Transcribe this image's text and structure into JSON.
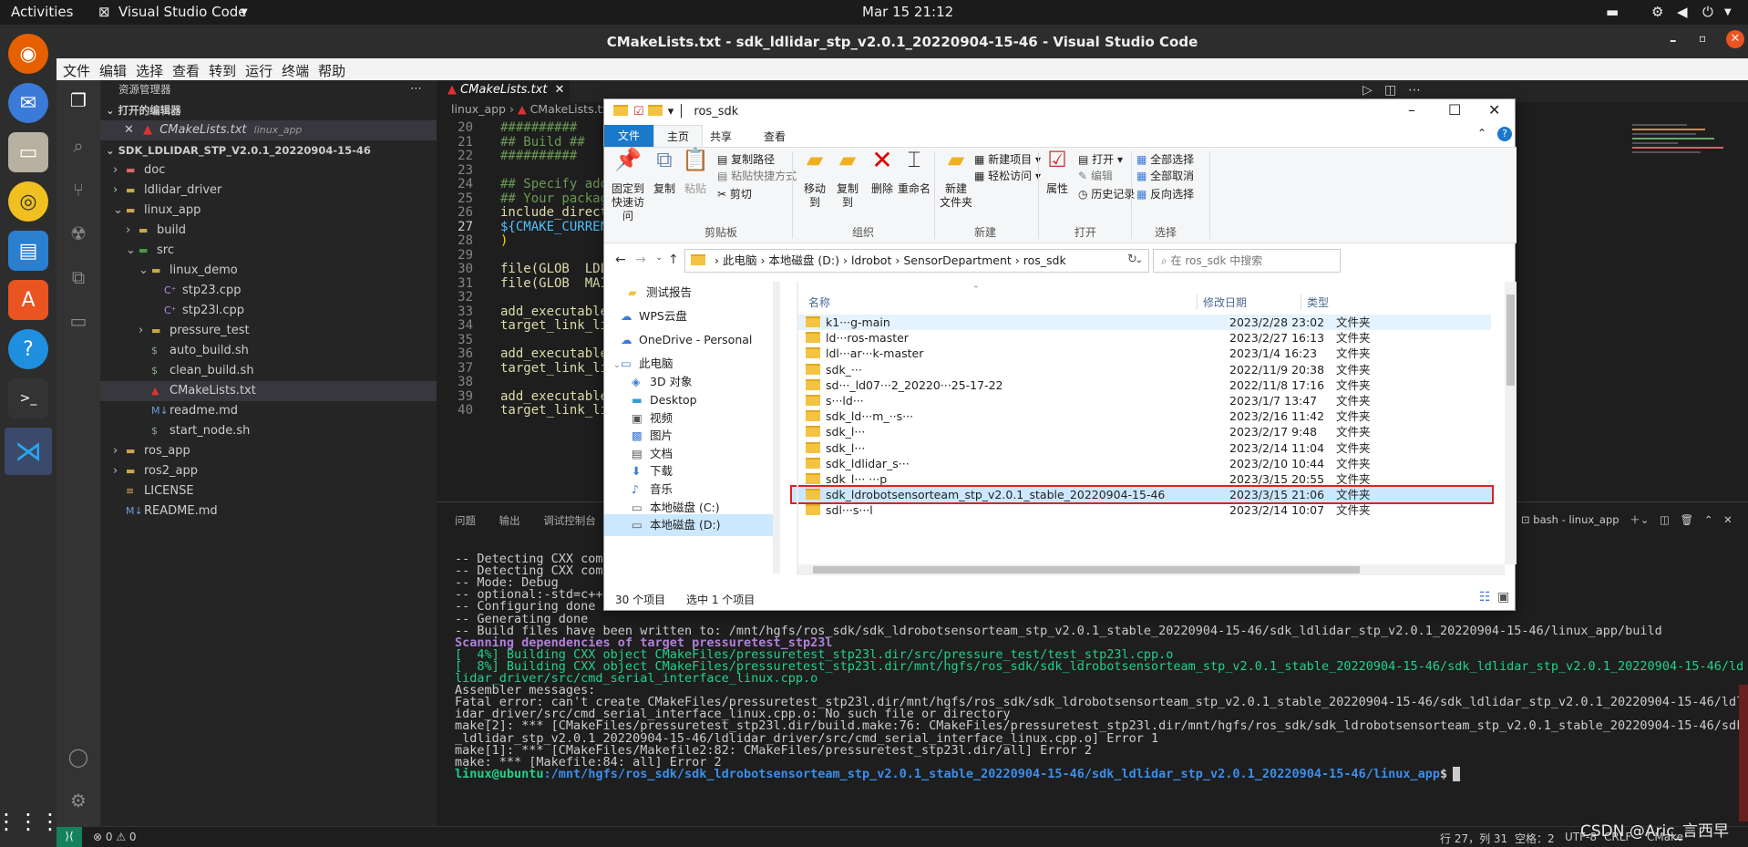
{
  "topbar": {
    "activities": "Activities",
    "app": "Visual Studio Code",
    "clock": "Mar 15  21:12"
  },
  "window_title": "CMakeLists.txt - sdk_ldlidar_stp_v2.0.1_20220904-15-46 - Visual Studio Code",
  "menu": [
    "文件",
    "编辑",
    "选择",
    "查看",
    "转到",
    "运行",
    "终端",
    "帮助"
  ],
  "sidebar": {
    "header": "资源管理器",
    "open_editors": "打开的编辑器",
    "open_file": "CMakeLists.txt",
    "open_file_path": "linux_app",
    "project": "SDK_LDLIDAR_STP_V2.0.1_20220904-15-46",
    "tree": [
      "doc",
      "ldlidar_driver",
      "linux_app",
      "build",
      "src",
      "linux_demo",
      "stp23.cpp",
      "stp23l.cpp",
      "pressure_test",
      "auto_build.sh",
      "clean_build.sh",
      "CMakeLists.txt",
      "readme.md",
      "start_node.sh",
      "ros_app",
      "ros2_app",
      "LICENSE",
      "README.md"
    ]
  },
  "editor": {
    "tab": "CMakeLists.txt",
    "breadcrumb": [
      "linux_app",
      "CMakeLists.txt"
    ],
    "line_numbers": [
      "20",
      "21",
      "22",
      "23",
      "24",
      "25",
      "26",
      "27",
      "28",
      "29",
      "30",
      "31",
      "32",
      "33",
      "34",
      "35",
      "36",
      "37",
      "38",
      "39",
      "40"
    ],
    "lines": [
      "##########",
      "## Build ##",
      "##########",
      "",
      "## Specify add",
      "## Your packag",
      "include_direct",
      "${CMAKE_CURREN",
      ")",
      "",
      "file(GLOB  LDL",
      "file(GLOB  MAI",
      "",
      "add_executable",
      "target_link_li",
      "",
      "add_executable",
      "target_link_li",
      "",
      "add_executable",
      "target_link_li"
    ]
  },
  "panel": {
    "tabs": [
      "问题",
      "输出",
      "调试控制台"
    ],
    "terminal_name": "bash - linux_app",
    "terminal": [
      "-- Detecting CXX comp",
      "-- Detecting CXX comp",
      "-- Mode: Debug",
      "-- optional:-std=c++1",
      "-- Configuring done",
      "-- Generating done",
      "-- Build files have been written to: /mnt/hgfs/ros_sdk/sdk_ldrobotsensorteam_stp_v2.0.1_stable_20220904-15-46/sdk_ldlidar_stp_v2.0.1_20220904-15-46/linux_app/build",
      "Scanning dependencies of target pressuretest_stp23l",
      "[  4%] Building CXX object CMakeFiles/pressuretest_stp23l.dir/src/pressure_test/test_stp23l.cpp.o",
      "[  8%] Building CXX object CMakeFiles/pressuretest_stp23l.dir/mnt/hgfs/ros_sdk/sdk_ldrobotsensorteam_stp_v2.0.1_stable_20220904-15-46/sdk_ldlidar_stp_v2.0.1_20220904-15-46/ld",
      "lidar_driver/src/cmd_serial_interface_linux.cpp.o",
      "Assembler messages:",
      "Fatal error: can't create CMakeFiles/pressuretest_stp23l.dir/mnt/hgfs/ros_sdk/sdk_ldrobotsensorteam_stp_v2.0.1_stable_20220904-15-46/sdk_ldlidar_stp_v2.0.1_20220904-15-46/ldl",
      "idar_driver/src/cmd_serial_interface_linux.cpp.o: No such file or directory",
      "make[2]: *** [CMakeFiles/pressuretest_stp23l.dir/build.make:76: CMakeFiles/pressuretest_stp23l.dir/mnt/hgfs/ros_sdk/sdk_ldrobotsensorteam_stp_v2.0.1_stable_20220904-15-46/sdk",
      "_ldlidar_stp_v2.0.1_20220904-15-46/ldlidar_driver/src/cmd_serial_interface_linux.cpp.o] Error 1",
      "make[1]: *** [CMakeFiles/Makefile2:82: CMakeFiles/pressuretest_stp23l.dir/all] Error 2",
      "make: *** [Makefile:84: all] Error 2"
    ],
    "prompt_user": "linux@ubuntu",
    "prompt_path": ":/mnt/hgfs/ros_sdk/sdk_ldrobotsensorteam_stp_v2.0.1_stable_20220904-15-46/sdk_ldlidar_stp_v2.0.1_20220904-15-46/linux_app",
    "prompt_sym": "$"
  },
  "statusbar": {
    "errors": "0",
    "warnings": "0",
    "position": "行 27，列 31",
    "spaces": "空格：2",
    "encoding": "UTF-8",
    "eol": "CRLF",
    "lang": "CMake",
    "watermark": "CSDN @Aric_言西早"
  },
  "explorer": {
    "title": "ros_sdk",
    "ribbon_tabs": [
      "文件",
      "主页",
      "共享",
      "查看"
    ],
    "clipboard": {
      "pin": "固定到快速访问",
      "copy": "复制",
      "paste": "粘贴",
      "copy_path": "复制路径",
      "paste_shortcut": "粘贴快捷方式",
      "cut": "剪切",
      "group": "剪贴板"
    },
    "organize": {
      "move": "移动到",
      "copyto": "复制到",
      "delete": "删除",
      "rename": "重命名",
      "group": "组织"
    },
    "new": {
      "folder": "新建\n文件夹",
      "item": "新建项目",
      "easy": "轻松访问",
      "group": "新建"
    },
    "open": {
      "props": "属性",
      "open": "打开",
      "edit": "编辑",
      "history": "历史记录",
      "group": "打开"
    },
    "select": {
      "all": "全部选择",
      "none": "全部取消",
      "invert": "反向选择",
      "group": "选择"
    },
    "address": [
      "此电脑",
      "本地磁盘 (D:)",
      "ldrobot",
      "SensorDepartment",
      "ros_sdk"
    ],
    "search_placeholder": "在 ros_sdk 中搜索",
    "nav": [
      "测试报告",
      "WPS云盘",
      "OneDrive - Personal",
      "此电脑",
      "3D 对象",
      "Desktop",
      "视频",
      "图片",
      "文档",
      "下载",
      "音乐",
      "本地磁盘 (C:)",
      "本地磁盘 (D:)"
    ],
    "columns": [
      "名称",
      "修改日期",
      "类型"
    ],
    "files": [
      {
        "name": "k1···g-main",
        "date": "2023/2/28 23:02",
        "type": "文件夹"
      },
      {
        "name": "ld···ros-master",
        "date": "2023/2/27 16:13",
        "type": "文件夹"
      },
      {
        "name": "ldl···ar···k-master",
        "date": "2023/1/4 16:23",
        "type": "文件夹"
      },
      {
        "name": "sdk_···",
        "date": "2022/11/9 20:38",
        "type": "文件夹"
      },
      {
        "name": "sd···_ld07···2_20220···25-17-22",
        "date": "2022/11/8 17:16",
        "type": "文件夹"
      },
      {
        "name": "s···ld···",
        "date": "2023/1/7 13:47",
        "type": "文件夹"
      },
      {
        "name": "sdk_ld···m_··s···",
        "date": "2023/2/16 11:42",
        "type": "文件夹"
      },
      {
        "name": "sdk_l···",
        "date": "2023/2/17 9:48",
        "type": "文件夹"
      },
      {
        "name": "sdk_l···",
        "date": "2023/2/14 11:04",
        "type": "文件夹"
      },
      {
        "name": "sdk_ldlidar_s···",
        "date": "2023/2/10 10:44",
        "type": "文件夹"
      },
      {
        "name": "sdk_l··· ···p",
        "date": "2023/3/15 20:55",
        "type": "文件夹"
      },
      {
        "name": "sdk_ldrobotsensorteam_stp_v2.0.1_stable_20220904-15-46",
        "date": "2023/3/15 21:06",
        "type": "文件夹"
      },
      {
        "name": "sdl···s···l",
        "date": "2023/2/14 10:07",
        "type": "文件夹"
      }
    ],
    "status_count": "30 个项目",
    "status_selected": "选中 1 个项目"
  }
}
